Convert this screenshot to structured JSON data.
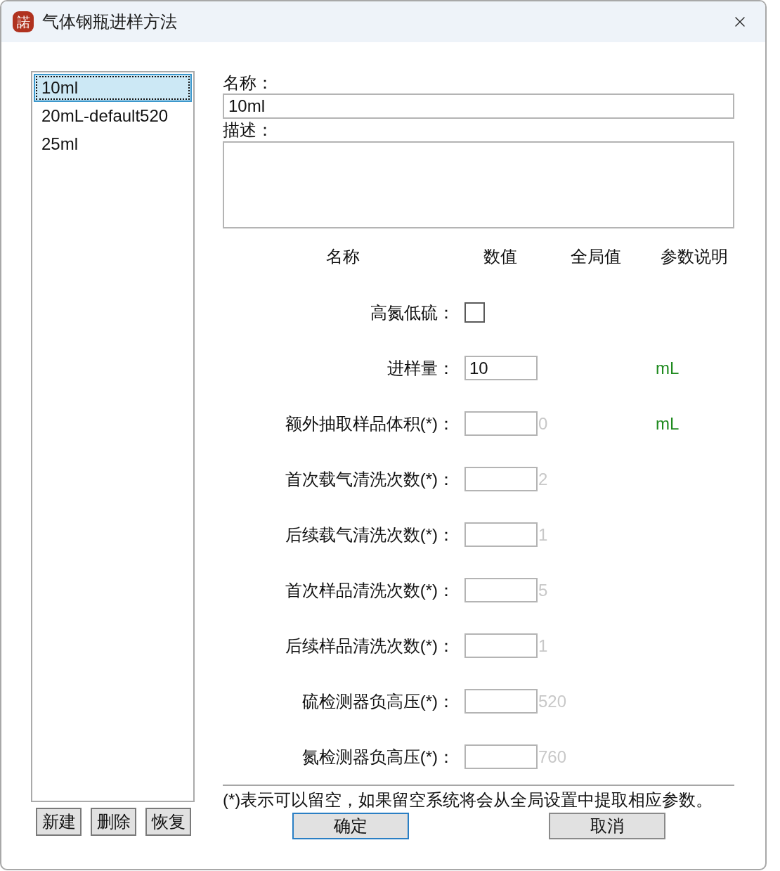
{
  "window": {
    "logo": "諾",
    "title": "气体钢瓶进样方法"
  },
  "methods": [
    {
      "label": "10ml",
      "selected": true
    },
    {
      "label": "20mL-default520",
      "selected": false
    },
    {
      "label": "25ml",
      "selected": false
    }
  ],
  "list_buttons": [
    "新建",
    "删除",
    "恢复"
  ],
  "name_field": {
    "label": "名称：",
    "value": "10ml"
  },
  "description_field": {
    "label": "描述："
  },
  "param_columns": [
    "名称",
    "数值",
    "全局值",
    "参数说明"
  ],
  "params": [
    {
      "kind": "checkbox",
      "label": "高氮低硫：",
      "checked": false
    },
    {
      "kind": "input",
      "label": "进样量：",
      "value": "10",
      "unit": "mL"
    },
    {
      "kind": "input",
      "label": "额外抽取样品体积(*)：",
      "global": "0",
      "unit": "mL"
    },
    {
      "kind": "input",
      "label": "首次载气清洗次数(*)：",
      "global": "2"
    },
    {
      "kind": "input",
      "label": "后续载气清洗次数(*)：",
      "global": "1"
    },
    {
      "kind": "input",
      "label": "首次样品清洗次数(*)：",
      "global": "5"
    },
    {
      "kind": "input",
      "label": "后续样品清洗次数(*)：",
      "global": "1"
    },
    {
      "kind": "input",
      "label": "硫检测器负高压(*)：",
      "global": "520"
    },
    {
      "kind": "input",
      "label": "氮检测器负高压(*)：",
      "global": "760"
    }
  ],
  "note": "(*)表示可以留空，如果留空系统将会从全局设置中提取相应参数。",
  "buttons": [
    {
      "label": "确定",
      "default": true
    },
    {
      "label": "取消",
      "default": false
    }
  ]
}
